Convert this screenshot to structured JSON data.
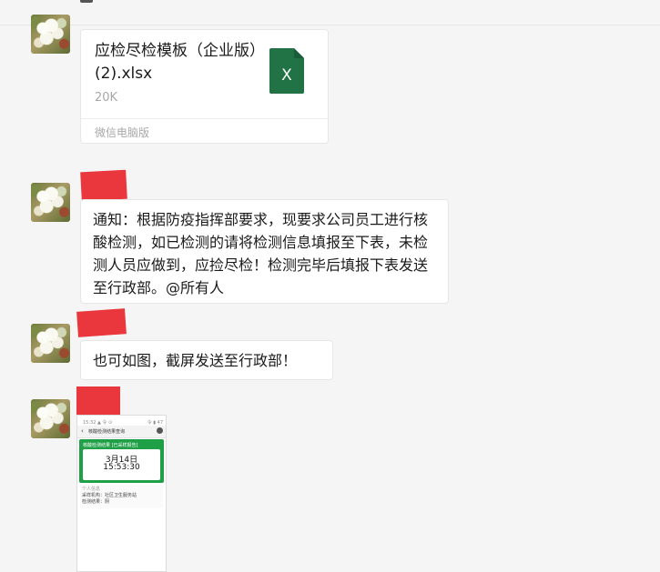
{
  "file_message": {
    "file_name": "应检尽检模板（企业版）(2).xlsx",
    "file_size": "20K",
    "source": "微信电脑版",
    "file_type_letter": "X",
    "file_icon_color": "#217346"
  },
  "messages": {
    "notice_text": "通知：根据防疫指挥部要求，现要求公司员工进行核酸检测，如已检测的请将检测信息填报至下表，未检测人员应做到，应捡尽检！检测完毕后填报下表发送至行政部。@所有人",
    "short_text": "也可如图，截屏发送至行政部！"
  },
  "image_message": {
    "status_time": "15:32 ▲ 令 ⊙",
    "status_right": "令 ▮ 47",
    "title": "核酸检测结果查询",
    "green_header": "核酸检测结果 [已采样报告]",
    "date": "3月14日",
    "time": "15:53:30",
    "info_line_1": "个人信息",
    "info_line_2": "采样机构：社区卫生服务站",
    "info_line_3": "检测结果：阴"
  },
  "colors": {
    "background": "#f5f5f5",
    "bubble": "#ffffff",
    "redaction": "#e8262c",
    "accent_green": "#1fa046"
  }
}
